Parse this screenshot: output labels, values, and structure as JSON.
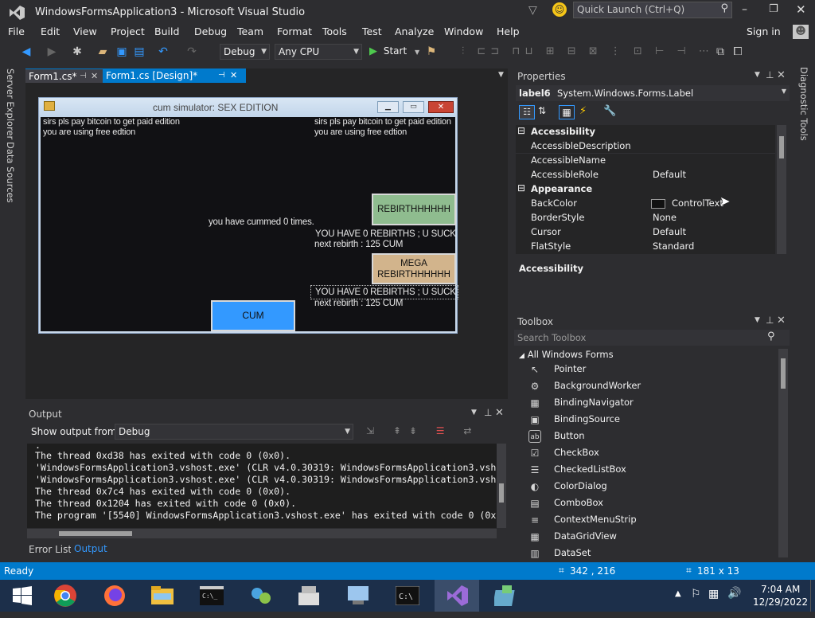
{
  "window": {
    "title": "WindowsFormsApplication3 - Microsoft Visual Studio",
    "quick_launch": "Quick Launch (Ctrl+Q)",
    "sign_in": "Sign in"
  },
  "menu": [
    "File",
    "Edit",
    "View",
    "Project",
    "Build",
    "Debug",
    "Team",
    "Format",
    "Tools",
    "Test",
    "Analyze",
    "Window",
    "Help"
  ],
  "toolbar": {
    "config": "Debug",
    "platform": "Any CPU",
    "start": "Start"
  },
  "left_tabs": [
    "Server Explorer",
    "Data Sources"
  ],
  "right_tabs": [
    "Diagnostic Tools"
  ],
  "doc_tabs": [
    {
      "label": "Form1.cs*"
    },
    {
      "label": "Form1.cs [Design]*"
    }
  ],
  "form": {
    "title": "cum simulator: SEX EDITION",
    "label_pay_left": "sirs pls pay bitcoin to  get paid edition",
    "label_free_left": "you are using free edtion",
    "label_pay_right": "sirs pls pay bitcoin to  get paid edition",
    "label_free_right": "you are using free edtion",
    "rebirth_button": "REBIRTHHHHHH",
    "cum_count": "you have cummed 0 times.",
    "rebirths_1": "YOU HAVE  0 REBIRTHS ; U SUCK",
    "next_rebirth_1": "next rebirth  : 125 CUM",
    "mega_button_1": "MEGA",
    "mega_button_2": "REBIRTHHHHHH",
    "rebirths_2": "YOU HAVE  0 REBIRTHS ; U SUCK",
    "next_rebirth_2": "next rebirth  : 125 CUM",
    "cum_button": "CUM",
    "colors": {
      "rebirth": "#8fbc8f",
      "mega": "#d2b48c",
      "cum": "#3399ff"
    }
  },
  "output": {
    "title": "Output",
    "show_from_label": "Show output from:",
    "source": "Debug",
    "lines": [
      "The thread 0xd38 has exited with code 0 (0x0).",
      "'WindowsFormsApplication3.vshost.exe' (CLR v4.0.30319: WindowsFormsApplication3.vsh",
      "'WindowsFormsApplication3.vshost.exe' (CLR v4.0.30319: WindowsFormsApplication3.vsh",
      "The thread 0x7c4 has exited with code 0 (0x0).",
      "The thread 0x1204 has exited with code 0 (0x0).",
      "The program '[5540] WindowsFormsApplication3.vshost.exe' has exited with code 0 (0x"
    ],
    "tabs": [
      "Error List",
      "Output"
    ]
  },
  "properties": {
    "title": "Properties",
    "object_name": "label6",
    "object_type": "System.Windows.Forms.Label",
    "rows": [
      {
        "kind": "cat",
        "name": "Accessibility",
        "sign": "⊟"
      },
      {
        "kind": "prop",
        "name": "AccessibleDescription",
        "value": ""
      },
      {
        "kind": "prop",
        "name": "AccessibleName",
        "value": ""
      },
      {
        "kind": "prop",
        "name": "AccessibleRole",
        "value": "Default"
      },
      {
        "kind": "cat",
        "name": "Appearance",
        "sign": "⊟"
      },
      {
        "kind": "prop",
        "name": "BackColor",
        "value": "ControlText",
        "swatch": "#111111"
      },
      {
        "kind": "prop",
        "name": "BorderStyle",
        "value": "None"
      },
      {
        "kind": "prop",
        "name": "Cursor",
        "value": "Default"
      },
      {
        "kind": "prop",
        "name": "FlatStyle",
        "value": "Standard"
      }
    ],
    "description_title": "Accessibility"
  },
  "toolbox": {
    "title": "Toolbox",
    "search_placeholder": "Search Toolbox",
    "group": "All Windows Forms",
    "items": [
      {
        "label": "Pointer",
        "icon": "↖"
      },
      {
        "label": "BackgroundWorker",
        "icon": "⚙"
      },
      {
        "label": "BindingNavigator",
        "icon": "▦"
      },
      {
        "label": "BindingSource",
        "icon": "▣"
      },
      {
        "label": "Button",
        "icon": "ab"
      },
      {
        "label": "CheckBox",
        "icon": "☑"
      },
      {
        "label": "CheckedListBox",
        "icon": "☰"
      },
      {
        "label": "ColorDialog",
        "icon": "◐"
      },
      {
        "label": "ComboBox",
        "icon": "▤"
      },
      {
        "label": "ContextMenuStrip",
        "icon": "≡"
      },
      {
        "label": "DataGridView",
        "icon": "▦"
      },
      {
        "label": "DataSet",
        "icon": "▥"
      }
    ]
  },
  "status": {
    "text": "Ready",
    "position": "342 , 216",
    "size": "181 x 13"
  },
  "taskbar": {
    "time": "7:04 AM",
    "date": "12/29/2022"
  }
}
